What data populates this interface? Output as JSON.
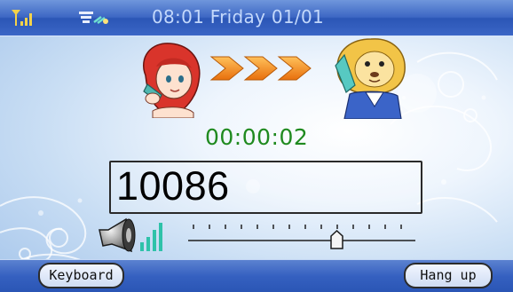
{
  "status_bar": {
    "datetime": "08:01 Friday 01/01",
    "icons": [
      "signal-strength-icon",
      "network-filter-icon"
    ]
  },
  "call": {
    "direction_icon": "triple-arrow-right-icon",
    "caller_avatar": "girl-on-phone-icon",
    "callee_avatar": "lion-on-phone-icon",
    "timer": "00:00:02",
    "number": "10086"
  },
  "volume": {
    "icon": "speaker-icon",
    "level": 0.67
  },
  "softkeys": {
    "left_label": "Keyboard",
    "right_label": "Hang up"
  },
  "colors": {
    "timer": "#1f8a1f",
    "arrows": "#f08a14",
    "statusbar": "#3d67c4"
  }
}
